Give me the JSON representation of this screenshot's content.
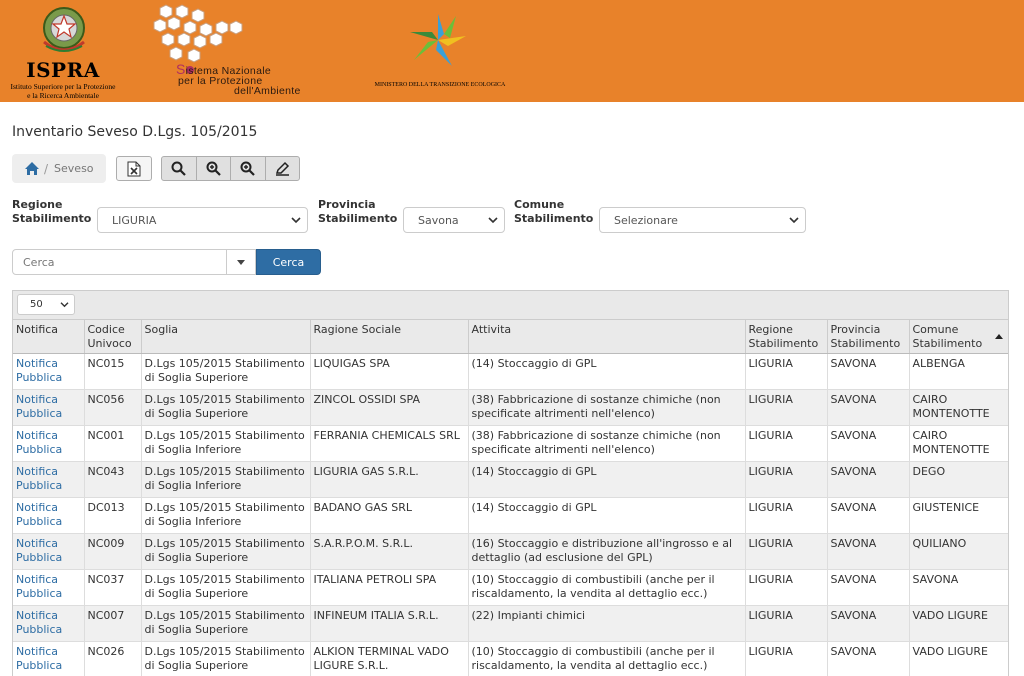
{
  "header": {
    "ispra_name": "ISPRA",
    "ispra_sub_1": "Istituto Superiore per la Protezione",
    "ispra_sub_2": "e la Ricerca Ambientale",
    "snpa_line1": "istema Nazionale",
    "snpa_line2": "per la Protezione",
    "snpa_line3": "dell'Ambiente",
    "ministry": "MINISTERO DELLA TRANSIZIONE ECOLOGICA",
    "colors": {
      "header_bg": "#e8822a",
      "link": "#2e6da4",
      "primary_button": "#2e6da4"
    }
  },
  "page_title": "Inventario Seveso D.Lgs. 105/2015",
  "breadcrumb": {
    "home_icon": "home-icon",
    "current": "Seveso"
  },
  "toolbar": {
    "icons": [
      "excel-export-icon",
      "search-icon",
      "zoom-in-icon",
      "zoom-in-icon",
      "edit-icon"
    ]
  },
  "filters": {
    "regione_label_1": "Regione",
    "regione_label_2": "Stabilimento",
    "regione_value": "LIGURIA",
    "provincia_label_1": "Provincia",
    "provincia_label_2": "Stabilimento",
    "provincia_value": "Savona",
    "comune_label_1": "Comune",
    "comune_label_2": "Stabilimento",
    "comune_value": "Selezionare"
  },
  "search": {
    "placeholder": "Cerca",
    "button": "Cerca"
  },
  "table": {
    "page_size": "50",
    "columns": {
      "notifica": "Notifica",
      "codice_1": "Codice",
      "codice_2": "Univoco",
      "soglia": "Soglia",
      "ragione": "Ragione Sociale",
      "attivita": "Attivita",
      "regione_1": "Regione",
      "regione_2": "Stabilimento",
      "provincia_1": "Provincia",
      "provincia_2": "Stabilimento",
      "comune_1": "Comune",
      "comune_2": "Stabilimento"
    },
    "rows": [
      {
        "n1": "Notifica",
        "n2": "Pubblica",
        "codice": "NC015",
        "s1": "D.Lgs 105/2015 Stabilimento",
        "s2": "di Soglia Superiore",
        "r1": "LIQUIGAS SPA",
        "r2": "",
        "a1": "(14) Stoccaggio di GPL",
        "a2": "",
        "regione": "LIGURIA",
        "provincia": "SAVONA",
        "c1": "ALBENGA",
        "c2": ""
      },
      {
        "n1": "Notifica",
        "n2": "Pubblica",
        "codice": "NC056",
        "s1": "D.Lgs 105/2015 Stabilimento",
        "s2": "di Soglia Superiore",
        "r1": "ZINCOL OSSIDI SPA",
        "r2": "",
        "a1": "(38) Fabbricazione di sostanze chimiche (non",
        "a2": "specificate altrimenti nell'elenco)",
        "regione": "LIGURIA",
        "provincia": "SAVONA",
        "c1": "CAIRO",
        "c2": "MONTENOTTE"
      },
      {
        "n1": "Notifica",
        "n2": "Pubblica",
        "codice": "NC001",
        "s1": "D.Lgs 105/2015 Stabilimento",
        "s2": "di Soglia Inferiore",
        "r1": "FERRANIA CHEMICALS SRL",
        "r2": "",
        "a1": "(38) Fabbricazione di sostanze chimiche (non",
        "a2": "specificate altrimenti nell'elenco)",
        "regione": "LIGURIA",
        "provincia": "SAVONA",
        "c1": "CAIRO",
        "c2": "MONTENOTTE"
      },
      {
        "n1": "Notifica",
        "n2": "Pubblica",
        "codice": "NC043",
        "s1": "D.Lgs 105/2015 Stabilimento",
        "s2": "di Soglia Inferiore",
        "r1": "LIGURIA GAS S.R.L.",
        "r2": "",
        "a1": "(14) Stoccaggio di GPL",
        "a2": "",
        "regione": "LIGURIA",
        "provincia": "SAVONA",
        "c1": "DEGO",
        "c2": ""
      },
      {
        "n1": "Notifica",
        "n2": "Pubblica",
        "codice": "DC013",
        "s1": "D.Lgs 105/2015 Stabilimento",
        "s2": "di Soglia Inferiore",
        "r1": "BADANO GAS SRL",
        "r2": "",
        "a1": "(14) Stoccaggio di GPL",
        "a2": "",
        "regione": "LIGURIA",
        "provincia": "SAVONA",
        "c1": "GIUSTENICE",
        "c2": ""
      },
      {
        "n1": "Notifica",
        "n2": "Pubblica",
        "codice": "NC009",
        "s1": "D.Lgs 105/2015 Stabilimento",
        "s2": "di Soglia Superiore",
        "r1": "S.A.R.P.O.M. S.R.L.",
        "r2": "",
        "a1": "(16) Stoccaggio e distribuzione all'ingrosso e al",
        "a2": "dettaglio (ad esclusione del GPL)",
        "regione": "LIGURIA",
        "provincia": "SAVONA",
        "c1": "QUILIANO",
        "c2": ""
      },
      {
        "n1": "Notifica",
        "n2": "Pubblica",
        "codice": "NC037",
        "s1": "D.Lgs 105/2015 Stabilimento",
        "s2": "di Soglia Superiore",
        "r1": "ITALIANA PETROLI SPA",
        "r2": "",
        "a1": "(10) Stoccaggio di combustibili (anche per il",
        "a2": "riscaldamento, la vendita al dettaglio ecc.)",
        "regione": "LIGURIA",
        "provincia": "SAVONA",
        "c1": "SAVONA",
        "c2": ""
      },
      {
        "n1": "Notifica",
        "n2": "Pubblica",
        "codice": "NC007",
        "s1": "D.Lgs 105/2015 Stabilimento",
        "s2": "di Soglia Superiore",
        "r1": "INFINEUM ITALIA S.R.L.",
        "r2": "",
        "a1": "(22) Impianti chimici",
        "a2": "",
        "regione": "LIGURIA",
        "provincia": "SAVONA",
        "c1": "VADO LIGURE",
        "c2": ""
      },
      {
        "n1": "Notifica",
        "n2": "Pubblica",
        "codice": "NC026",
        "s1": "D.Lgs 105/2015 Stabilimento",
        "s2": "di Soglia Superiore",
        "r1": "ALKION TERMINAL VADO",
        "r2": "LIGURE S.R.L.",
        "a1": "(10) Stoccaggio di combustibili (anche per il",
        "a2": "riscaldamento, la vendita al dettaglio ecc.)",
        "regione": "LIGURIA",
        "provincia": "SAVONA",
        "c1": "VADO LIGURE",
        "c2": ""
      }
    ]
  }
}
